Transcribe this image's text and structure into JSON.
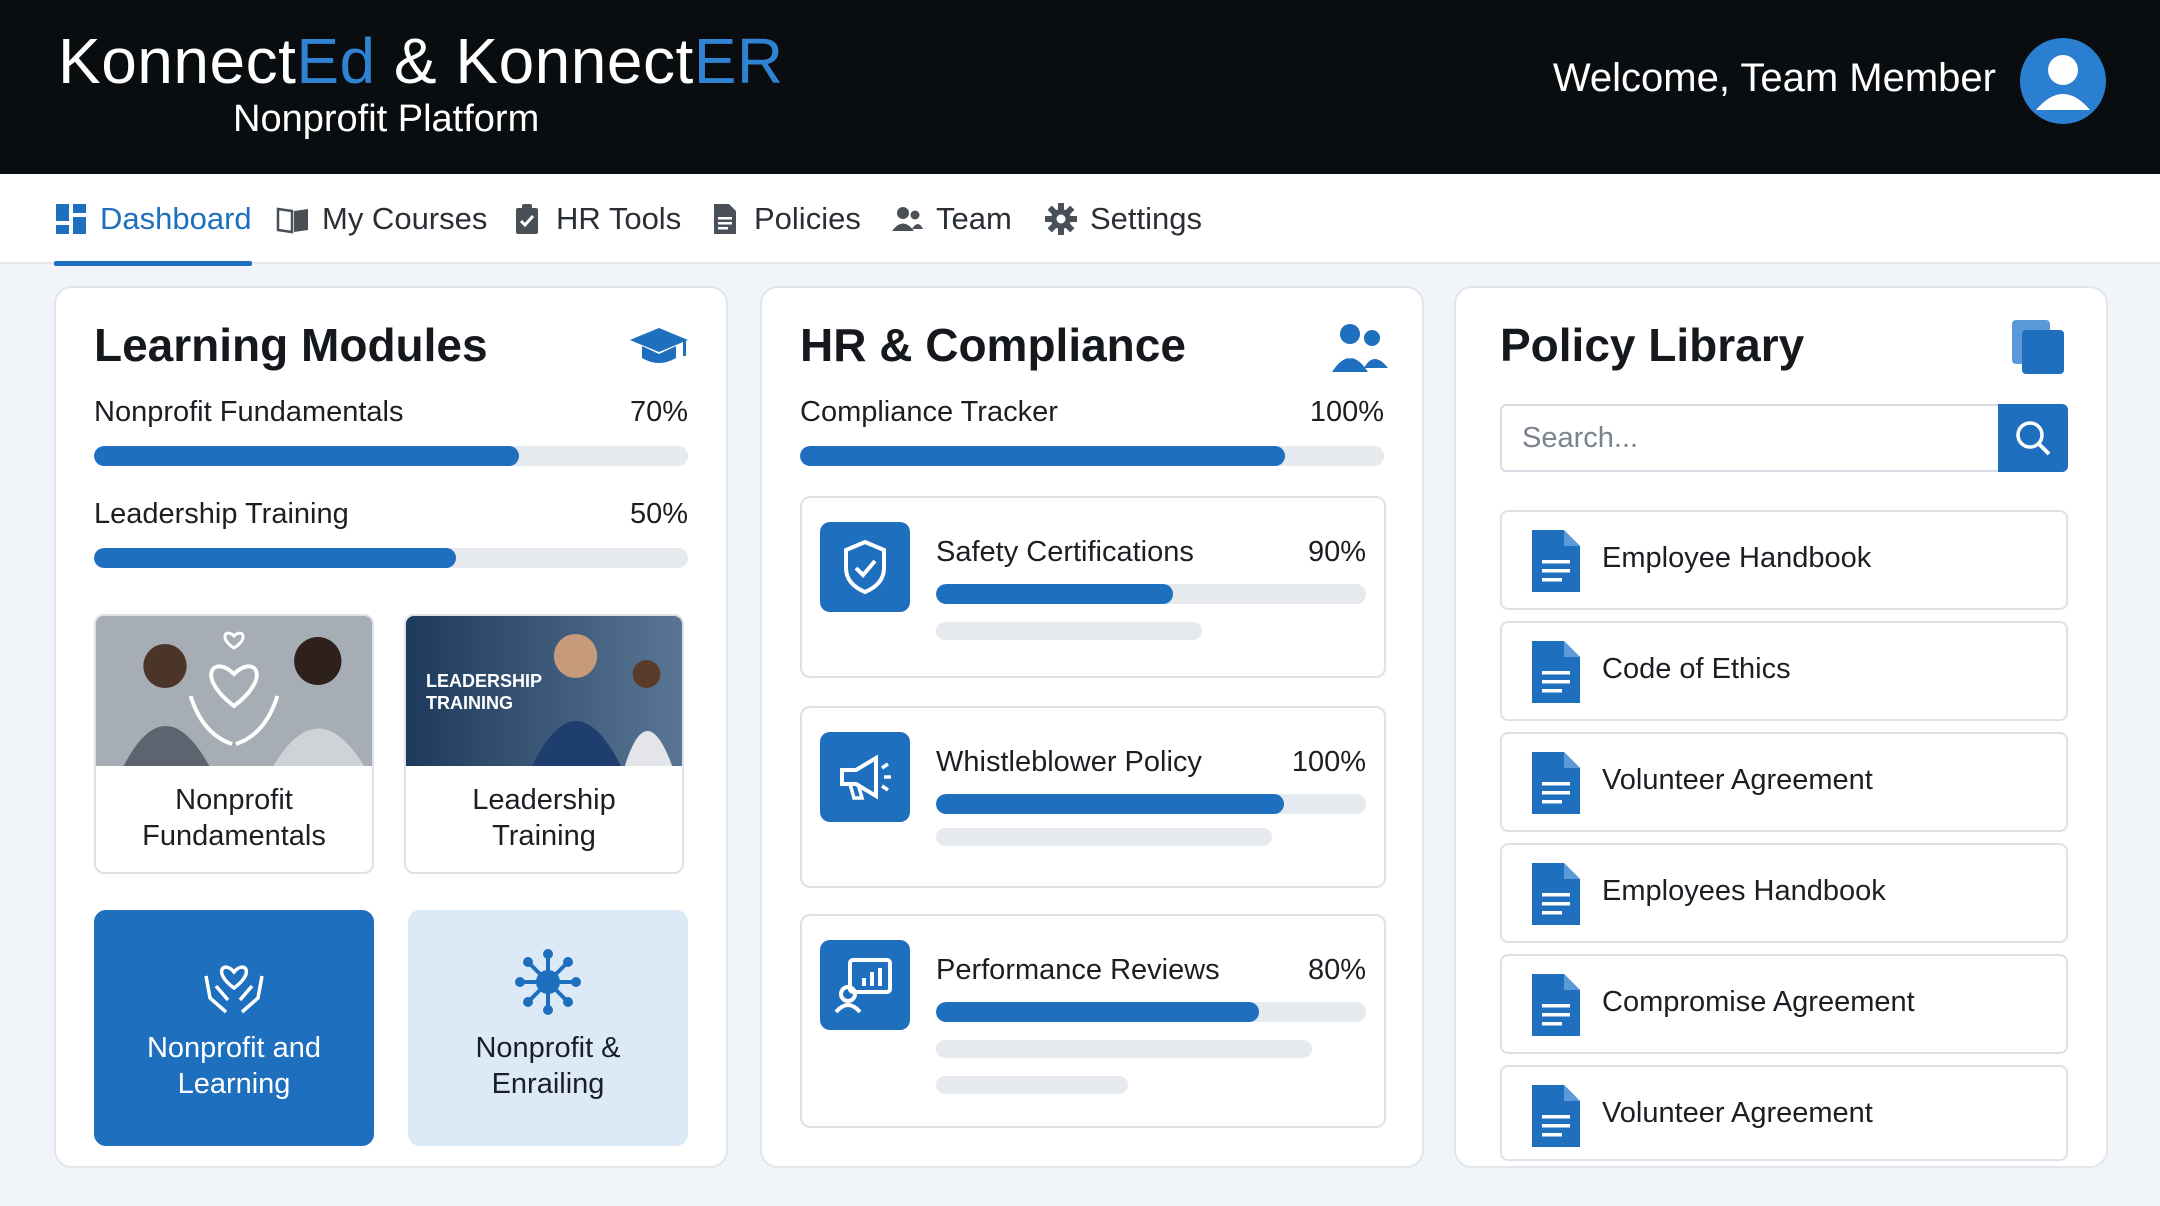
{
  "header": {
    "brand_part1": "Konnect",
    "brand_part2": "Ed",
    "brand_part3": " & Konnect",
    "brand_part4": "ER",
    "subtitle": "Nonprofit Platform",
    "welcome": "Welcome, Team Member"
  },
  "nav": {
    "items": [
      {
        "label": "Dashboard",
        "icon": "dashboard-icon",
        "active": true
      },
      {
        "label": "My Courses",
        "icon": "book-icon"
      },
      {
        "label": "HR Tools",
        "icon": "clipboard-icon"
      },
      {
        "label": "Policies",
        "icon": "document-icon"
      },
      {
        "label": "Team",
        "icon": "team-icon"
      },
      {
        "label": "Settings",
        "icon": "gear-icon"
      }
    ]
  },
  "learning": {
    "title": "Learning Modules",
    "icon": "graduation-cap-icon",
    "progress": [
      {
        "label": "Nonprofit Fundamentals",
        "value": "70%",
        "fraction": 0.715
      },
      {
        "label": "Leadership Training",
        "value": "50%",
        "fraction": 0.61
      }
    ],
    "courses": [
      {
        "name": "Nonprofit Fundamentals"
      },
      {
        "name": "Leadership Training",
        "image_text": "LEADERSHIP TRAINING"
      }
    ],
    "tiles": [
      {
        "label": "Nonprofit and Learning",
        "icon": "hands-heart-icon"
      },
      {
        "label": "Nonprofit & Enrailing",
        "icon": "network-icon"
      }
    ]
  },
  "hr": {
    "title": "HR & Compliance",
    "icon": "people-icon",
    "tracker": {
      "label": "Compliance Tracker",
      "value": "100%",
      "fraction": 0.83
    },
    "items": [
      {
        "label": "Safety Certifications",
        "value": "90%",
        "fraction": 0.55,
        "icon": "shield-check-icon"
      },
      {
        "label": "Whistleblower Policy",
        "value": "100%",
        "fraction": 0.81,
        "icon": "megaphone-icon"
      },
      {
        "label": "Performance Reviews",
        "value": "80%",
        "fraction": 0.75,
        "icon": "performance-icon"
      }
    ]
  },
  "policy": {
    "title": "Policy Library",
    "icon": "documents-stack-icon",
    "search_placeholder": "Search...",
    "documents": [
      "Employee Handbook",
      "Code of Ethics",
      "Volunteer Agreement",
      "Employees Handbook",
      "Compromise Agreement",
      "Volunteer Agreement"
    ]
  },
  "colors": {
    "accent": "#1f6fbf",
    "header_bg": "#0a0d10",
    "brand_accent": "#2e83d3"
  }
}
